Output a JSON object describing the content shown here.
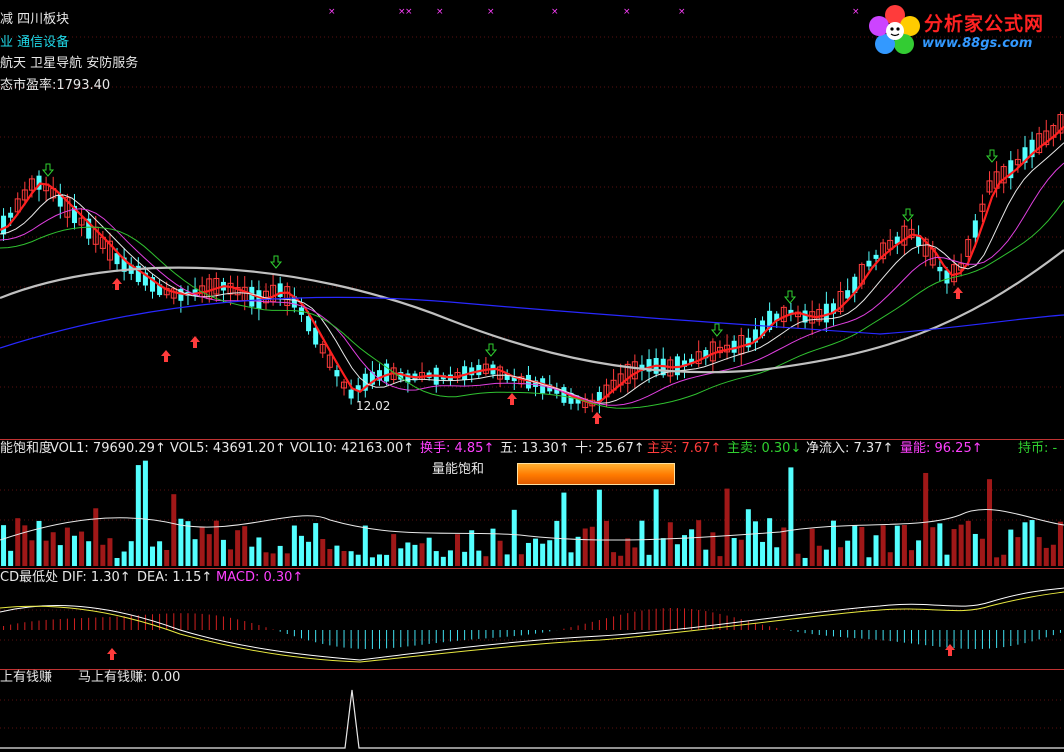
{
  "top_info": {
    "line1": "减 四川板块",
    "line2": "业 通信设备",
    "line3": "航天 卫星导航 安防服务",
    "line4": "态市盈率:1793.40"
  },
  "logo": {
    "title": "分析家公式网",
    "url": "www.88gs.com"
  },
  "price_panel": {
    "low_price_label": "12.02"
  },
  "volume_header": {
    "name": "能饱和度",
    "vol1": "VOL1: 79690.29↑",
    "vol5": "VOL5: 43691.20↑",
    "vol10": "VOL10: 42163.00↑",
    "turnover": "换手: 4.85↑",
    "five": "五: 13.30↑",
    "ten": "十: 25.67↑",
    "main_buy": "主买: 7.67↑",
    "main_sell": "主卖: 0.30↓",
    "net_inflow": "净流入: 7.37↑",
    "energy": "量能: 96.25↑",
    "hold": "持币: -"
  },
  "saturation": {
    "label": "量能饱和",
    "level": 1.0
  },
  "macd_header": {
    "name": "CD最低处",
    "dif": "DIF: 1.30↑",
    "dea": "DEA: 1.15↑",
    "macd": "MACD: 0.30↑"
  },
  "bottom_header": {
    "name": "上有钱赚",
    "value": "马上有钱赚: 0.00"
  },
  "colors": {
    "up": "#ff3c3c",
    "down": "#54ffff",
    "ma_red": "#ff2020",
    "ma_white": "#e8e8e8",
    "ma_purple": "#e040e0",
    "ma_green": "#30c030",
    "ma_gray": "#c0c0c0",
    "ma_blue": "#2828ff",
    "separator": "#c03232",
    "label_cyan": "#20d8e8",
    "label_magenta": "#ff40ff"
  }
}
